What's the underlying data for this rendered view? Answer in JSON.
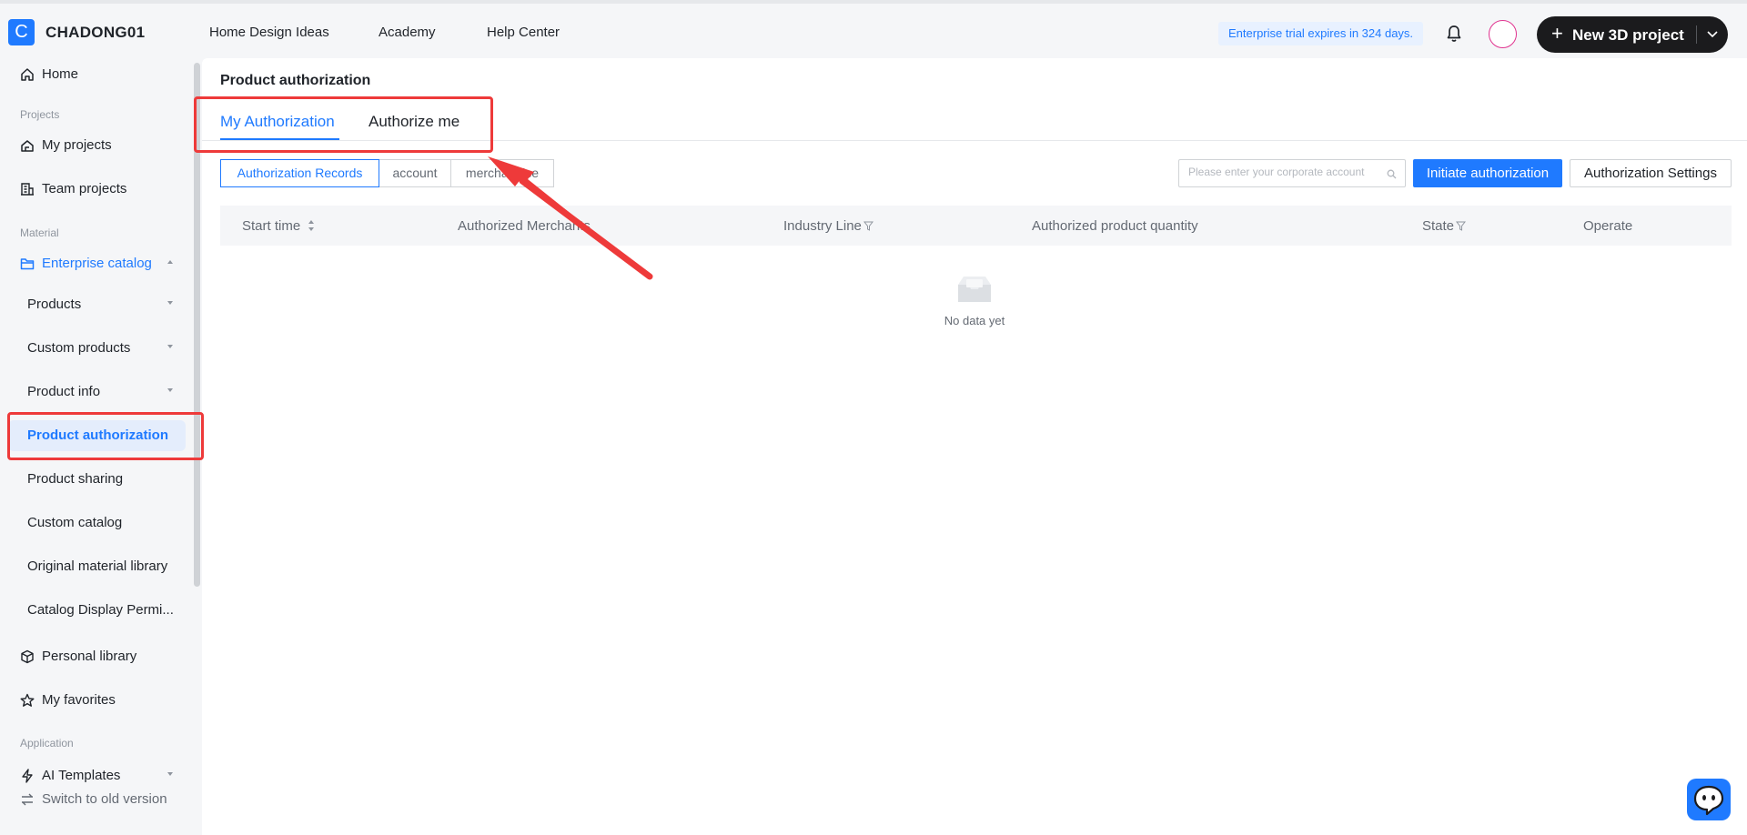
{
  "topbar": {
    "logo_letter": "C",
    "brand": "CHADONG01",
    "nav": [
      "Home Design Ideas",
      "Academy",
      "Help Center"
    ],
    "trial_notice": "Enterprise trial expires in 324 days.",
    "new_project_label": "New 3D project"
  },
  "sidebar": {
    "home": "Home",
    "group_projects": "Projects",
    "my_projects": "My projects",
    "team_projects": "Team projects",
    "group_material": "Material",
    "enterprise_catalog": "Enterprise catalog",
    "products": "Products",
    "custom_products": "Custom products",
    "product_info": "Product info",
    "product_authorization": "Product authorization",
    "product_sharing": "Product sharing",
    "custom_catalog": "Custom catalog",
    "original_material_library": "Original material library",
    "catalog_display_permissions": "Catalog Display Permi...",
    "personal_library": "Personal library",
    "my_favorites": "My favorites",
    "group_application": "Application",
    "ai_templates": "AI Templates",
    "switch_old": "Switch to old version"
  },
  "main": {
    "page_title": "Product authorization",
    "tabs": [
      "My Authorization",
      "Authorize me"
    ],
    "segments": [
      "Authorization Records",
      "account",
      "merchandise"
    ],
    "search_placeholder": "Please enter your corporate account",
    "initiate_button": "Initiate authorization",
    "settings_button": "Authorization Settings",
    "columns": [
      "Start time",
      "Authorized Merchants",
      "Industry Line",
      "Authorized product quantity",
      "State",
      "Operate"
    ],
    "empty_text": "No data yet"
  },
  "colors": {
    "accent": "#1f7aff",
    "annotation": "#ee3a3a"
  }
}
